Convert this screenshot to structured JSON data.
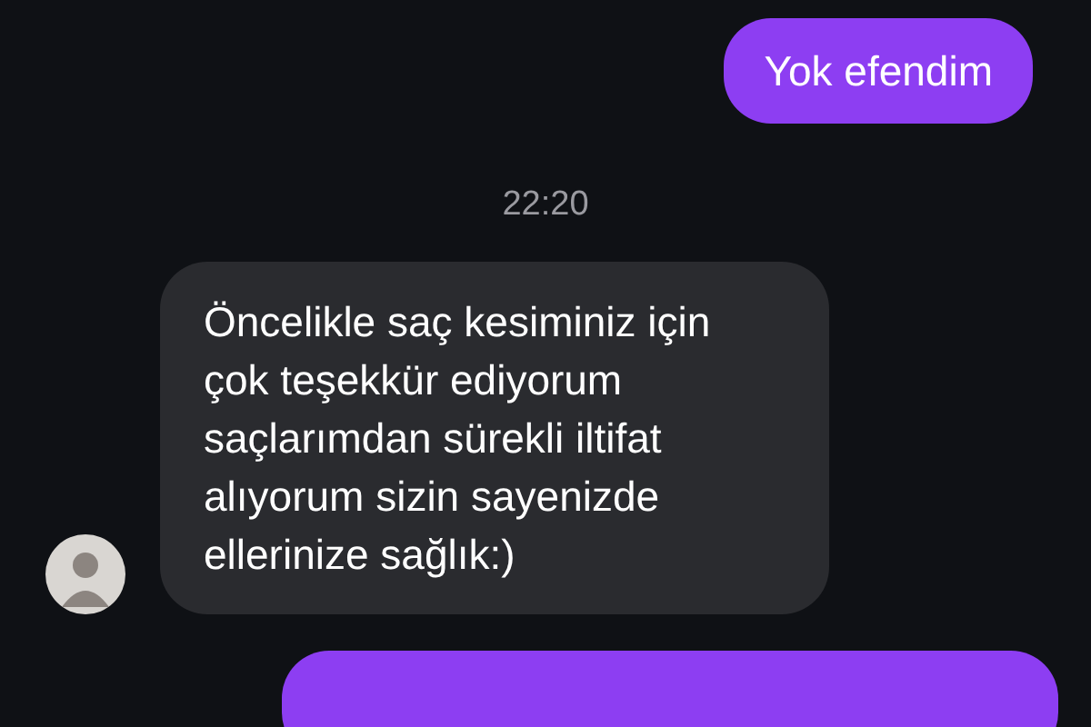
{
  "messages": [
    {
      "kind": "outgoing",
      "text": "Yok efendim"
    },
    {
      "kind": "timestamp",
      "text": "22:20"
    },
    {
      "kind": "incoming",
      "text": "Öncelikle saç kesiminiz için çok teşekkür ediyorum saçlarımdan sürekli iltifat alıyorum sizin sayenizde ellerinize sağlık:)"
    },
    {
      "kind": "outgoing-cut"
    }
  ]
}
